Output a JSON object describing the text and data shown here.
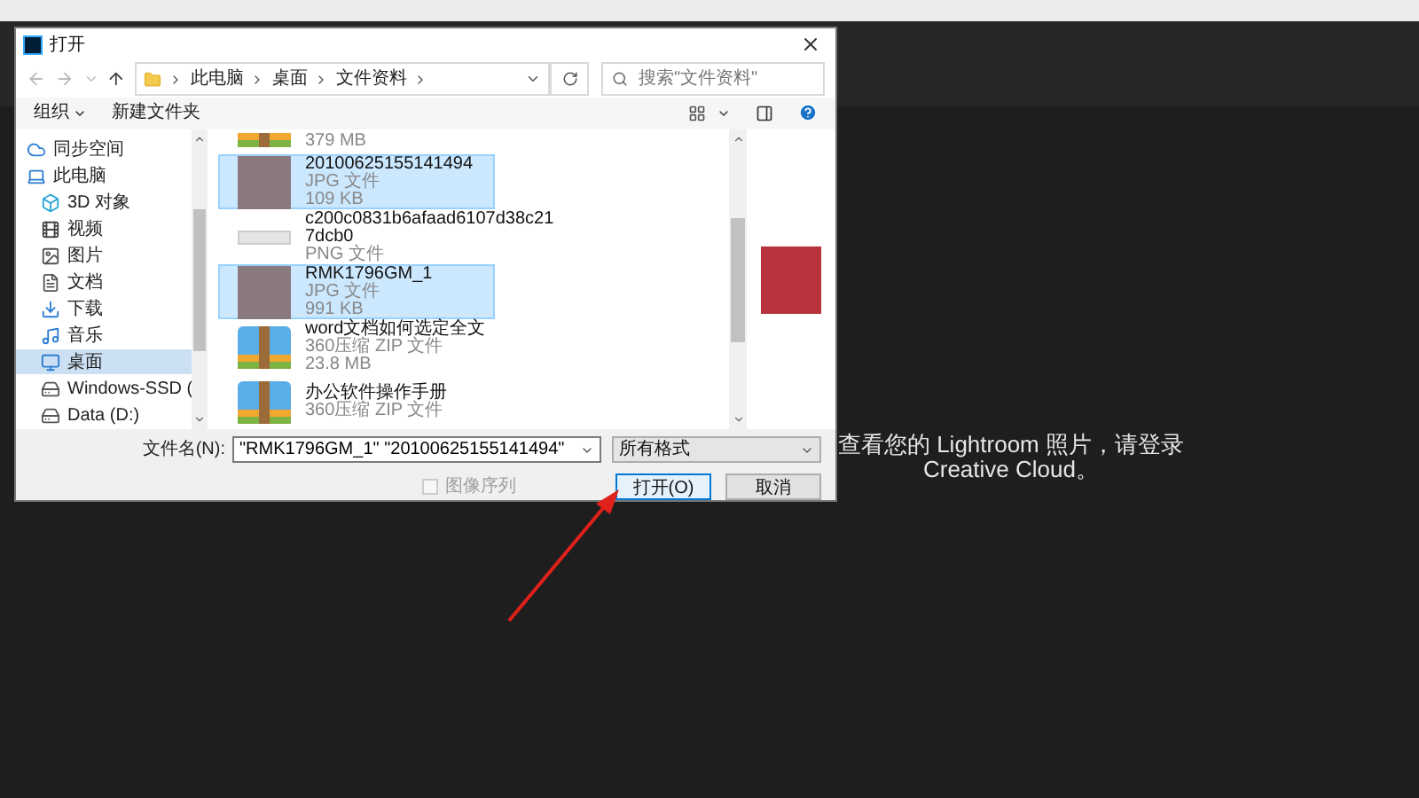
{
  "dialog": {
    "title": "打开",
    "address": {
      "crumbs": [
        "此电脑",
        "桌面",
        "文件资料"
      ]
    },
    "search": {
      "placeholder": "搜索\"文件资料\""
    },
    "toolbar": {
      "organize": "组织",
      "new_folder": "新建文件夹"
    },
    "sidebar": [
      {
        "label": "同步空间",
        "selected": false
      },
      {
        "label": "此电脑",
        "selected": false,
        "children": [
          {
            "label": "3D 对象",
            "selected": false
          },
          {
            "label": "视频",
            "selected": false
          },
          {
            "label": "图片",
            "selected": false
          },
          {
            "label": "文档",
            "selected": false
          },
          {
            "label": "下载",
            "selected": false
          },
          {
            "label": "音乐",
            "selected": false
          },
          {
            "label": "桌面",
            "selected": true
          },
          {
            "label": "Windows-SSD (",
            "selected": false
          },
          {
            "label": "Data (D:)",
            "selected": false
          }
        ]
      }
    ],
    "files": [
      {
        "kind": "zip",
        "size": "379 MB",
        "selected": false
      },
      {
        "kind": "photo",
        "name": "20100625155141494",
        "type": "JPG 文件",
        "size": "109 KB",
        "selected": true
      },
      {
        "kind": "png",
        "name": "c200c0831b6afaad6107d38c217dcb0",
        "type": "PNG 文件",
        "selected": false
      },
      {
        "kind": "photo",
        "name": "RMK1796GM_1",
        "type": "JPG 文件",
        "size": "991 KB",
        "selected": true
      },
      {
        "kind": "zip",
        "name": "word文档如何选定全文",
        "type": "360压缩 ZIP 文件",
        "size": "23.8 MB",
        "selected": false
      },
      {
        "kind": "zip",
        "name": "办公软件操作手册",
        "type": "360压缩 ZIP 文件",
        "selected": false
      }
    ],
    "filename_label": "文件名(N):",
    "filename": "\"RMK1796GM_1\" \"20100625155141494\"",
    "filetype": "所有格式",
    "image_sequence": {
      "label": "图像序列",
      "checked": false,
      "disabled": true
    },
    "buttons": [
      "打开(O)",
      "取消"
    ]
  },
  "message_lines": [
    "查看您的 Lightroom 照片，请登录",
    "Creative Cloud。"
  ]
}
